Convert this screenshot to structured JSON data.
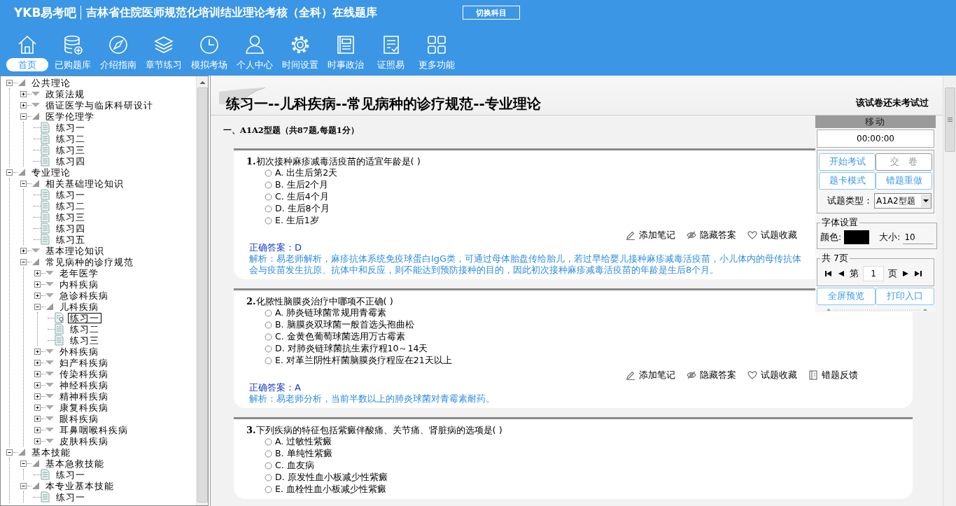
{
  "header": {
    "logo": "YKB易考吧",
    "title": "吉林省住院医师规范化培训结业理论考核（全科）在线题库",
    "switch_button": "切换科目"
  },
  "toolbar": [
    {
      "label": "首页",
      "selected": true
    },
    {
      "label": "已购题库",
      "selected": false
    },
    {
      "label": "介绍指南",
      "selected": false
    },
    {
      "label": "章节练习",
      "selected": false
    },
    {
      "label": "模拟考场",
      "selected": false
    },
    {
      "label": "个人中心",
      "selected": false
    },
    {
      "label": "时间设置",
      "selected": false
    },
    {
      "label": "时事政治",
      "selected": false
    },
    {
      "label": "证照易",
      "selected": false
    },
    {
      "label": "更多功能",
      "selected": false
    }
  ],
  "tree": [
    {
      "label": "公共理论",
      "kind": "folder",
      "expanded": true,
      "children": [
        {
          "label": "政策法规",
          "kind": "folder",
          "expanded": false
        },
        {
          "label": "循证医学与临床科研设计",
          "kind": "folder",
          "expanded": false
        },
        {
          "label": "医学伦理学",
          "kind": "folder",
          "expanded": true,
          "children": [
            {
              "label": "练习一",
              "kind": "leaf",
              "selected": false
            },
            {
              "label": "练习二",
              "kind": "leaf",
              "selected": false
            },
            {
              "label": "练习三",
              "kind": "leaf",
              "selected": false
            },
            {
              "label": "练习四",
              "kind": "leaf",
              "selected": false
            }
          ]
        }
      ]
    },
    {
      "label": "专业理论",
      "kind": "folder",
      "expanded": true,
      "children": [
        {
          "label": "相关基础理论知识",
          "kind": "folder",
          "expanded": true,
          "children": [
            {
              "label": "练习一",
              "kind": "leaf",
              "selected": false
            },
            {
              "label": "练习二",
              "kind": "leaf",
              "selected": false
            },
            {
              "label": "练习三",
              "kind": "leaf",
              "selected": false
            },
            {
              "label": "练习四",
              "kind": "leaf",
              "selected": false
            },
            {
              "label": "练习五",
              "kind": "leaf",
              "selected": false
            }
          ]
        },
        {
          "label": "基本理论知识",
          "kind": "folder",
          "expanded": false
        },
        {
          "label": "常见病种的诊疗规范",
          "kind": "folder",
          "expanded": true,
          "children": [
            {
              "label": "老年医学",
              "kind": "folder",
              "expanded": false
            },
            {
              "label": "内科疾病",
              "kind": "folder",
              "expanded": false
            },
            {
              "label": "急诊科疾病",
              "kind": "folder",
              "expanded": false
            },
            {
              "label": "儿科疾病",
              "kind": "folder",
              "expanded": true,
              "children": [
                {
                  "label": "练习一",
                  "kind": "leaf",
                  "selected": true
                },
                {
                  "label": "练习二",
                  "kind": "leaf",
                  "selected": false
                },
                {
                  "label": "练习三",
                  "kind": "leaf",
                  "selected": false
                }
              ]
            },
            {
              "label": "外科疾病",
              "kind": "folder",
              "expanded": false
            },
            {
              "label": "妇产科疾病",
              "kind": "folder",
              "expanded": false
            },
            {
              "label": "传染科疾病",
              "kind": "folder",
              "expanded": false
            },
            {
              "label": "神经科疾病",
              "kind": "folder",
              "expanded": false
            },
            {
              "label": "精神科疾病",
              "kind": "folder",
              "expanded": false
            },
            {
              "label": "康复科疾病",
              "kind": "folder",
              "expanded": false
            },
            {
              "label": "眼科疾病",
              "kind": "folder",
              "expanded": false
            },
            {
              "label": "耳鼻咽喉科疾病",
              "kind": "folder",
              "expanded": false
            },
            {
              "label": "皮肤科疾病",
              "kind": "folder",
              "expanded": false
            }
          ]
        }
      ]
    },
    {
      "label": "基本技能",
      "kind": "folder",
      "expanded": true,
      "children": [
        {
          "label": "基本急救技能",
          "kind": "folder",
          "expanded": true,
          "children": [
            {
              "label": "练习一",
              "kind": "leaf",
              "selected": false
            }
          ]
        },
        {
          "label": "本专业基本技能",
          "kind": "folder",
          "expanded": true,
          "children": [
            {
              "label": "练习一",
              "kind": "leaf",
              "selected": false
            }
          ]
        }
      ]
    }
  ],
  "exam": {
    "title": "练习一--儿科疾病--常见病种的诊疗规范--专业理论",
    "status": "该试卷还未考试过",
    "section": "一、A1A2型题（共87题,每题1分）",
    "questions": [
      {
        "number": "1.",
        "text": "初次接种麻疹减毒活疫苗的适宜年龄是( )",
        "options": [
          {
            "label": "A.",
            "text": "出生后第2天",
            "selected": false
          },
          {
            "label": "B.",
            "text": "生后2个月",
            "selected": false
          },
          {
            "label": "C.",
            "text": "生后4个月",
            "selected": false
          },
          {
            "label": "D.",
            "text": "生后8个月",
            "selected": false
          },
          {
            "label": "E.",
            "text": "生后1岁",
            "selected": false
          }
        ],
        "actions": [
          "添加笔记",
          "隐藏答案",
          "试题收藏"
        ],
        "answer": "正确答案：D",
        "analysis": "解析：易老师解析，麻疹抗体系统免疫球蛋白IgG类，可通过母体胎盘传给胎儿，若过早给婴儿接种麻疹减毒活疫苗，小儿体内的母传抗体会与疫苗发生抗原、抗体中和反应，则不能达到预防接种的目的，因此初次接种麻疹减毒活疫苗的年龄是生后8个月。"
      },
      {
        "number": "2.",
        "text": "化脓性脑膜炎治疗中哪项不正确( )",
        "options": [
          {
            "label": "A.",
            "text": "肺炎链球菌常规用青霉素",
            "selected": false
          },
          {
            "label": "B.",
            "text": "脑膜炎双球菌一般首选头孢曲松",
            "selected": false
          },
          {
            "label": "C.",
            "text": "金黄色葡萄球菌选用万古霉素",
            "selected": false
          },
          {
            "label": "D.",
            "text": "对肺炎链球菌抗生素疗程10～14天",
            "selected": false
          },
          {
            "label": "E.",
            "text": "对革兰阴性杆菌脑膜炎疗程应在21天以上",
            "selected": false
          }
        ],
        "actions": [
          "添加笔记",
          "隐藏答案",
          "试题收藏",
          "错题反馈"
        ],
        "answer": "正确答案：A",
        "analysis": "解析：易老师分析，当前半数以上的肺炎球菌对青霉素耐药。"
      },
      {
        "number": "3.",
        "text": "下列疾病的特征包括紫癜伴酸痛、关节痛、肾脏病的选项是( )",
        "options": [
          {
            "label": "A.",
            "text": "过敏性紫癜",
            "selected": false
          },
          {
            "label": "B.",
            "text": "单纯性紫癜",
            "selected": false
          },
          {
            "label": "C.",
            "text": "血友病",
            "selected": false
          },
          {
            "label": "D.",
            "text": "原发性血小板减少性紫癜",
            "selected": false
          },
          {
            "label": "E.",
            "text": "血栓性血小板减少性紫癜",
            "selected": false
          }
        ]
      }
    ]
  },
  "panel": {
    "title": "移动",
    "timer": "00:00:00",
    "buttons": [
      {
        "label": "开始考试",
        "disabled": false
      },
      {
        "label": "交　卷",
        "disabled": true
      },
      {
        "label": "题卡模式",
        "disabled": false
      },
      {
        "label": "错题重做",
        "disabled": false
      }
    ],
    "type_label": "试题类型：",
    "type_value": "A1A2型题",
    "font_group": "字体设置",
    "color_label": "颜色:",
    "color": "#000000",
    "size_label": "大小:",
    "size_value": "10",
    "pages_group": "共 7页",
    "page_prefix": "第",
    "page_value": "1",
    "page_suffix": "页",
    "bottom_buttons": [
      {
        "label": "全屏预览",
        "disabled": false
      },
      {
        "label": "打印入口",
        "disabled": false
      }
    ]
  }
}
